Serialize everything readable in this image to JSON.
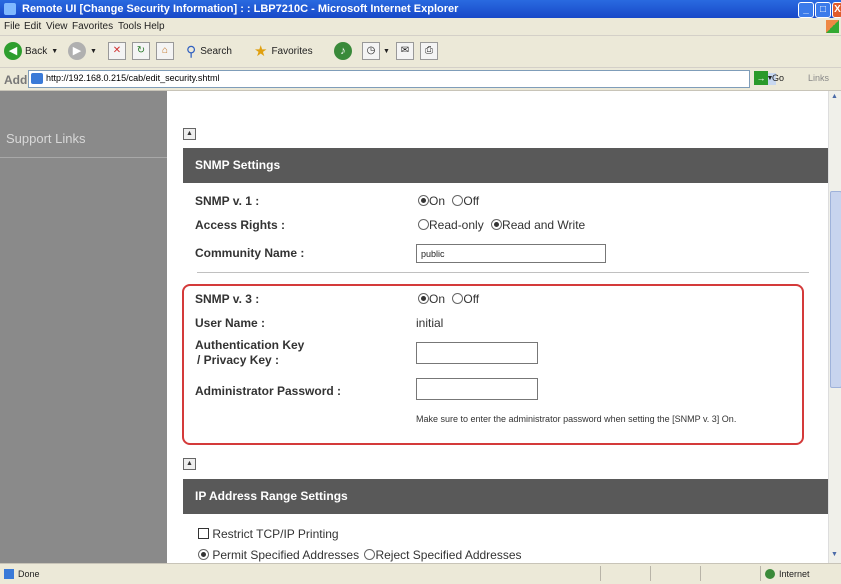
{
  "window": {
    "title": "Remote UI [Change Security Information] : : LBP7210C - Microsoft Internet Explorer",
    "minimize": "_",
    "maximize": "□",
    "close": "X"
  },
  "menu": {
    "items": [
      "File",
      "Edit",
      "View",
      "Favorites",
      "Tools",
      "Help"
    ]
  },
  "toolbar": {
    "back": "Back",
    "search": "Search",
    "favorites": "Favorites"
  },
  "address": {
    "label": "Address",
    "url": "http://192.168.0.215/cab/edit_security.shtml",
    "go": "Go",
    "links": "Links"
  },
  "sidebar": {
    "support_links": "Support Links"
  },
  "collapse_glyph": "▲",
  "snmp": {
    "header": "SNMP Settings",
    "v1_label": "SNMP v. 1 :",
    "v1_value": "On",
    "on": "On",
    "off": "Off",
    "access_label": "Access Rights :",
    "access_value": "Read and Write",
    "read_only": "Read-only",
    "read_write": "Read and Write",
    "community_label": "Community Name :",
    "community_value": "public",
    "v3_label": "SNMP v. 3 :",
    "v3_value": "On",
    "username_label": "User Name :",
    "username_value": "initial",
    "authkey_label_line1": "Authentication Key",
    "authkey_label_line2": "/ Privacy Key :",
    "authkey_value": "",
    "admin_pw_label": "Administrator Password :",
    "admin_pw_value": "",
    "note": "Make sure to enter the administrator password when setting the [SNMP v. 3] On."
  },
  "ip": {
    "header": "IP Address Range Settings",
    "restrict_label": "Restrict TCP/IP Printing",
    "restrict_checked": false,
    "permit_label": "Permit Specified Addresses",
    "reject_label": "Reject Specified Addresses",
    "mode_value": "Permit Specified Addresses"
  },
  "status": {
    "left": "Done",
    "zone": "Internet"
  },
  "colors": {
    "section_header_bg": "#595959",
    "sidebar_bg": "#8a8a8a",
    "highlight_border": "#d43a3a",
    "titlebar": "#1848c8"
  }
}
